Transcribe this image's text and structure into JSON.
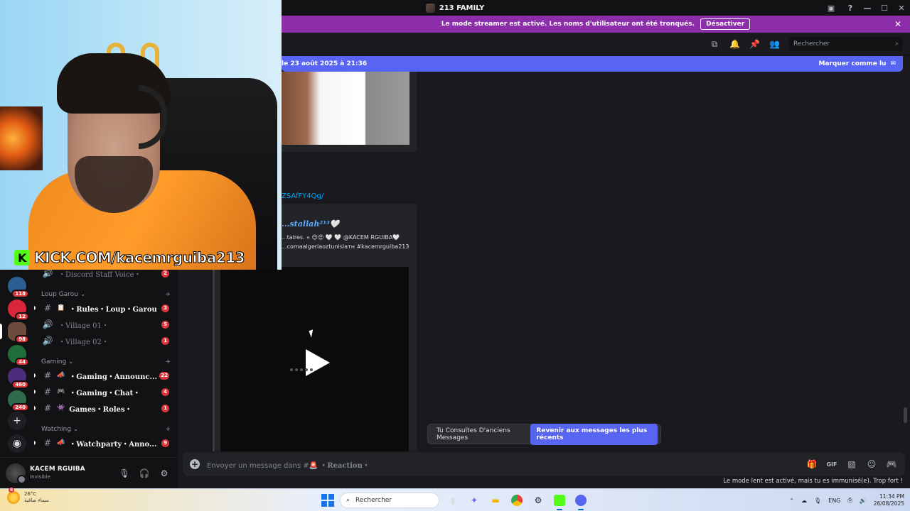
{
  "titlebar": {
    "title": "213 FAMILY"
  },
  "streamer_banner": {
    "text": "Le mode streamer est activé. Les noms d'utilisateur ont été tronqués.",
    "button": "Désactiver",
    "close": "✕"
  },
  "header": {
    "search_placeholder": "Rechercher"
  },
  "new_messages_bar": {
    "since": "le 23 août 2025 à 21:36",
    "mark_read": "Marquer comme lu"
  },
  "webcam": {
    "overlay_text": "KICK.COM/kacemrguiba213",
    "logo_letter": "K"
  },
  "servers": [
    {
      "badge": "118"
    },
    {
      "badge": "12"
    },
    {
      "badge": "98"
    },
    {
      "badge": "44"
    },
    {
      "badge": "460"
    },
    {
      "badge": "240"
    }
  ],
  "channels": {
    "items": [
      {
        "symbol": "🔊",
        "name": "・Discord Staff Voice・",
        "count": "2",
        "muted": true
      },
      {
        "category": "Loup Garou"
      },
      {
        "symbol": "#",
        "emoji": "📋",
        "name": "・Rules・Loup・Garou",
        "count": "3"
      },
      {
        "symbol": "🔊",
        "name": "・Village 01・",
        "count": "5",
        "muted": true
      },
      {
        "symbol": "🔊",
        "name": "・Village 02・",
        "count": "1",
        "muted": true
      },
      {
        "category": "Gaming"
      },
      {
        "symbol": "#",
        "emoji": "📣",
        "name": "・Gaming・Announc...",
        "count": "22"
      },
      {
        "symbol": "#",
        "emoji": "🎮",
        "name": "・Gaming・Chat・",
        "count": "4"
      },
      {
        "symbol": "#",
        "emoji": "👾",
        "name": "Games・Roles・",
        "count": "1"
      },
      {
        "category": "Watching"
      },
      {
        "symbol": "#",
        "emoji": "📣",
        "name": "・Watchparty・Anno...",
        "count": "9"
      }
    ]
  },
  "user": {
    "name": "KACEM RGUIBA",
    "status": "Invisible"
  },
  "chat": {
    "link_text": "ZSAfFY4Qg/",
    "embed_author": "...stallah²¹³🤍",
    "embed_desc_line1": "...taires. « 😍😍 🤍 🤍 @KACEM RGUIBA🤍",
    "embed_desc_line2": "...comaalgeriaoztunisiaтн #kacemrguiba213",
    "old_messages_text": "Tu Consultes D'anciens Messages",
    "jump_button": "Revenir aux messages les plus récents"
  },
  "composer": {
    "placeholder_prefix": "Envoyer un message dans #",
    "channel_name": "・Reaction・",
    "channel_emoji": "🚨"
  },
  "slowmode_text": "Le mode lent est activé, mais tu es immunisé(e). Trop fort !",
  "taskbar": {
    "temperature": "26°C",
    "weather_desc": "سماء صافية",
    "weather_badge": "6",
    "search_placeholder": "Rechercher",
    "language": "ENG",
    "time": "11:34 PM",
    "date": "26/08/2025"
  }
}
